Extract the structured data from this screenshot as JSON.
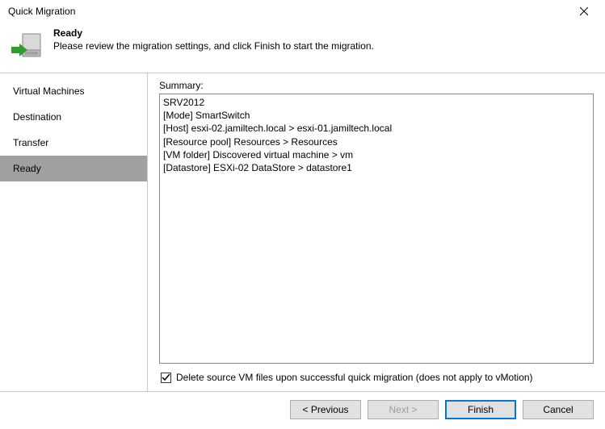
{
  "window": {
    "title": "Quick Migration"
  },
  "header": {
    "title": "Ready",
    "subtitle": "Please review the migration settings, and click Finish to start the migration."
  },
  "sidebar": {
    "items": [
      {
        "label": "Virtual Machines",
        "active": false
      },
      {
        "label": "Destination",
        "active": false
      },
      {
        "label": "Transfer",
        "active": false
      },
      {
        "label": "Ready",
        "active": true
      }
    ]
  },
  "main": {
    "summary_label": "Summary:",
    "summary_lines": [
      "SRV2012",
      "[Mode] SmartSwitch",
      "[Host] esxi-02.jamiltech.local > esxi-01.jamiltech.local",
      "[Resource pool] Resources > Resources",
      "[VM folder] Discovered virtual machine > vm",
      "[Datastore] ESXi-02 DataStore > datastore1"
    ],
    "checkbox": {
      "checked": true,
      "label": "Delete source VM files upon successful quick migration (does not apply to vMotion)"
    }
  },
  "footer": {
    "previous": "< Previous",
    "next": "Next >",
    "finish": "Finish",
    "cancel": "Cancel"
  }
}
